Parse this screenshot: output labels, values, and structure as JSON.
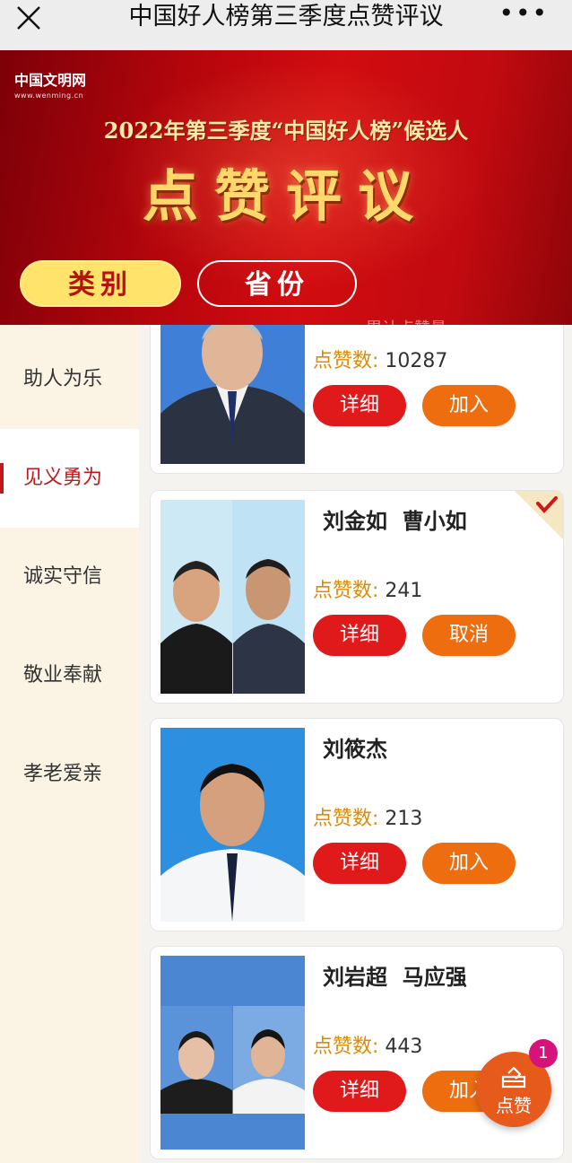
{
  "nav": {
    "title": "中国好人榜第三季度点赞评议",
    "close_icon": "close-icon",
    "more_label": "•••"
  },
  "banner": {
    "logo_main": "中国文明网",
    "logo_sub": "www.wenming.cn",
    "subtitle": "2022年第三季度“中国好人榜”候选人",
    "main_title": "点赞评议",
    "stray_text": "累计点赞量"
  },
  "filters": {
    "category": "类别",
    "province": "省份"
  },
  "sidebar": {
    "items": [
      {
        "label": "助人为乐"
      },
      {
        "label": "见义勇为"
      },
      {
        "label": "诚实守信"
      },
      {
        "label": "敬业奉献"
      },
      {
        "label": "孝老爱亲"
      }
    ],
    "active_index": 1
  },
  "likes_label": "点赞数:",
  "cards": [
    {
      "name": "",
      "likes": "10287",
      "detail": "详细",
      "action": "加入",
      "selected": false
    },
    {
      "name": "刘金如  曹小如",
      "likes": "241",
      "detail": "详细",
      "action": "取消",
      "selected": true
    },
    {
      "name": "刘筱杰",
      "likes": "213",
      "detail": "详细",
      "action": "加入",
      "selected": false
    },
    {
      "name": "刘岩超  马应强",
      "likes": "443",
      "detail": "详细",
      "action": "加入",
      "selected": false
    }
  ],
  "fab": {
    "label": "点赞",
    "badge": "1",
    "icon": "vote-box-icon"
  },
  "colors": {
    "banner_red": "#c10a10",
    "accent_red": "#e01a1a",
    "accent_orange": "#ee6d0e",
    "likes_orange": "#e08a00",
    "sidebar_bg": "#fbf4e4"
  }
}
